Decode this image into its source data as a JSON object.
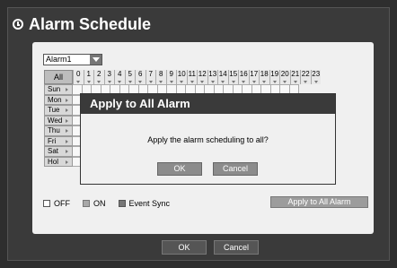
{
  "window": {
    "title": "Alarm Schedule"
  },
  "alarm_select": {
    "value": "Alarm1"
  },
  "grid": {
    "all_label": "All",
    "hours": [
      "0",
      "1",
      "2",
      "3",
      "4",
      "5",
      "6",
      "7",
      "8",
      "9",
      "10",
      "11",
      "12",
      "13",
      "14",
      "15",
      "16",
      "17",
      "18",
      "19",
      "20",
      "21",
      "22",
      "23"
    ],
    "days": [
      "Sun",
      "Mon",
      "Tue",
      "Wed",
      "Thu",
      "Fri",
      "Sat",
      "Hol"
    ]
  },
  "legend": {
    "off": "OFF",
    "on": "ON",
    "event_sync": "Event Sync"
  },
  "apply_all_button": "Apply to All Alarm",
  "footer": {
    "ok": "OK",
    "cancel": "Cancel"
  },
  "dialog": {
    "title": "Apply to All Alarm",
    "message": "Apply the alarm scheduling to all?",
    "ok": "OK",
    "cancel": "Cancel"
  }
}
